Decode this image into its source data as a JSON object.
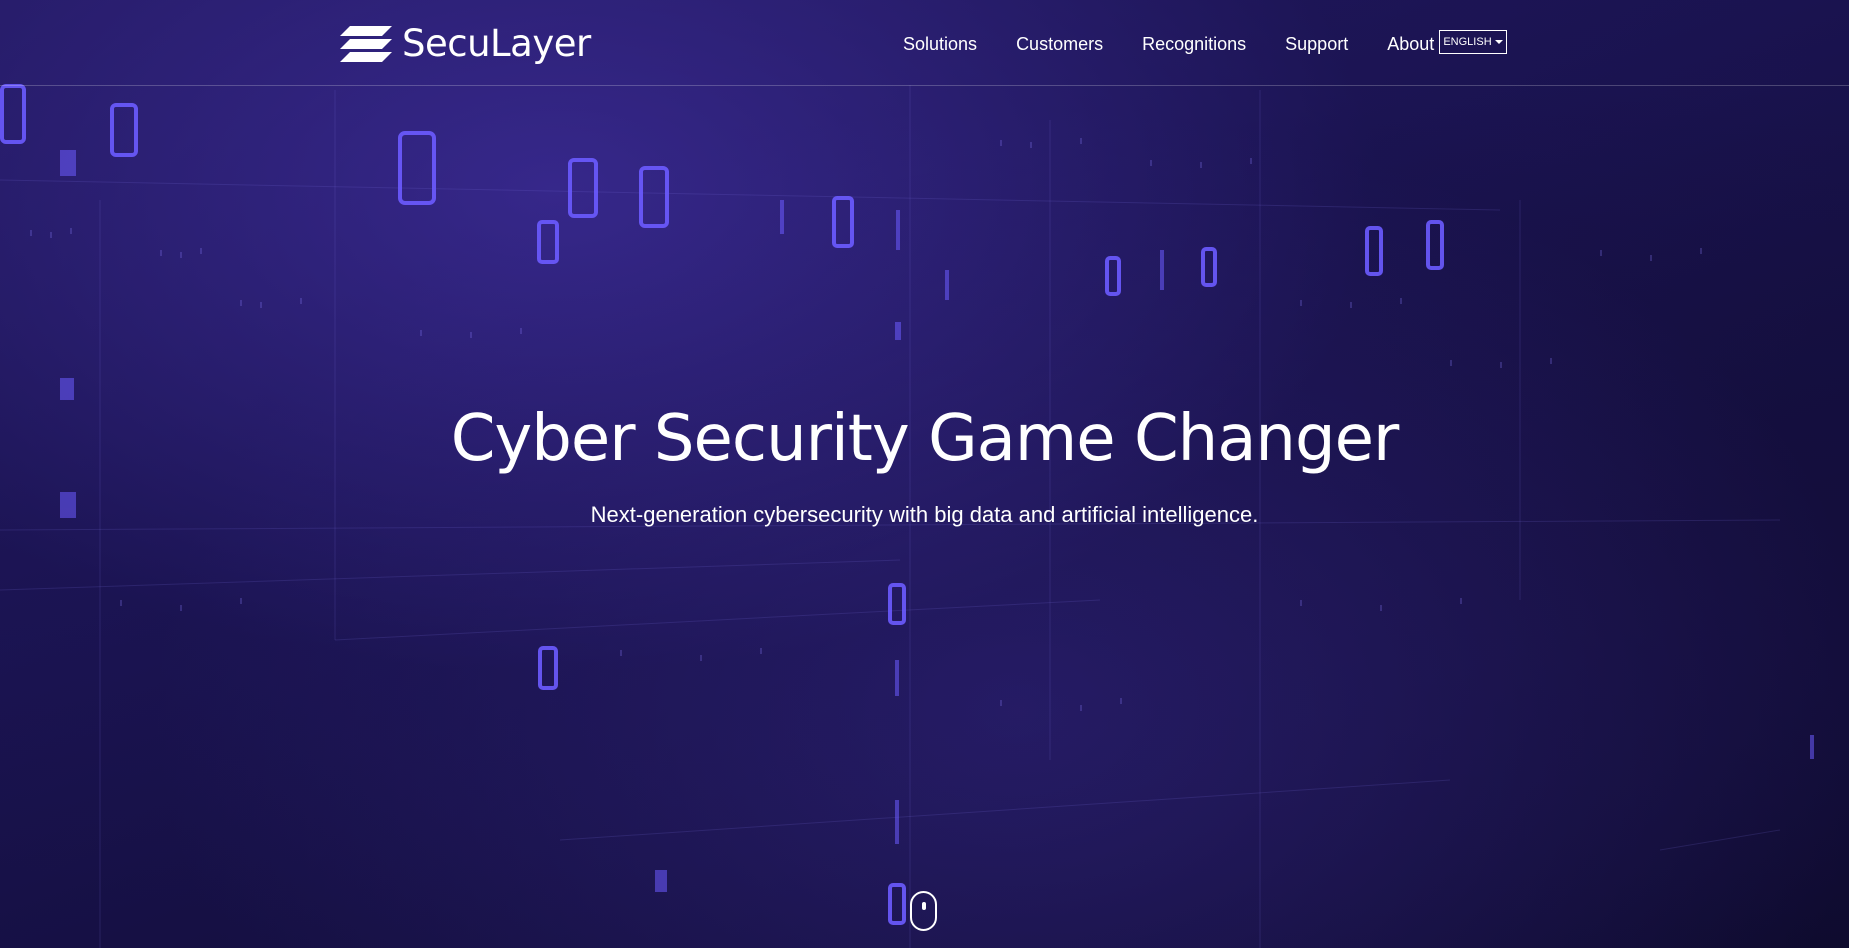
{
  "header": {
    "logo_text": "SecuLayer",
    "nav": [
      {
        "label": "Solutions"
      },
      {
        "label": "Customers"
      },
      {
        "label": "Recognitions"
      },
      {
        "label": "Support"
      },
      {
        "label": "About"
      }
    ],
    "language": "ENGLISH"
  },
  "hero": {
    "title": "Cyber Security Game Changer",
    "subtitle": "Next-generation cybersecurity with big data and artificial intelligence."
  },
  "icons": {
    "logo": "layers-icon",
    "language_caret": "caret-down-icon",
    "scroll": "mouse-scroll-icon"
  },
  "colors": {
    "background": "#1a1350",
    "accent": "#6a5cff",
    "text": "#ffffff"
  }
}
